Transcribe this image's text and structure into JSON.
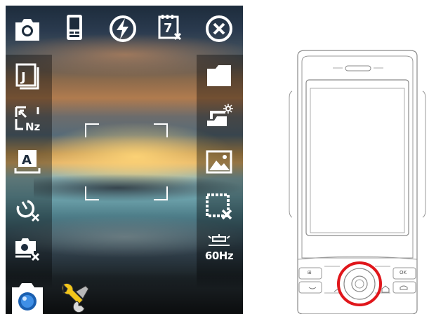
{
  "camera": {
    "icons": [
      {
        "name": "camera-mode-icon"
      },
      {
        "name": "device-icon"
      },
      {
        "name": "flash-icon"
      },
      {
        "name": "self-timer-icon"
      },
      {
        "name": "close-icon"
      },
      {
        "name": "capture-format-icon"
      },
      {
        "name": "folder-icon"
      },
      {
        "name": "zoom-icon"
      },
      {
        "name": "brightness-icon"
      },
      {
        "name": "auto-mode-icon"
      },
      {
        "name": "scene-icon"
      },
      {
        "name": "timer-off-icon"
      },
      {
        "name": "no-frame-icon"
      },
      {
        "name": "review-off-icon"
      },
      {
        "name": "flicker-adjust-icon"
      },
      {
        "name": "shutter-button-icon"
      },
      {
        "name": "settings-wrench-icon"
      }
    ],
    "flicker_label": "60Hz"
  },
  "phone": {
    "keys": {
      "start": "⊞",
      "ok": "OK"
    },
    "highlight_color": "#e0161b"
  }
}
